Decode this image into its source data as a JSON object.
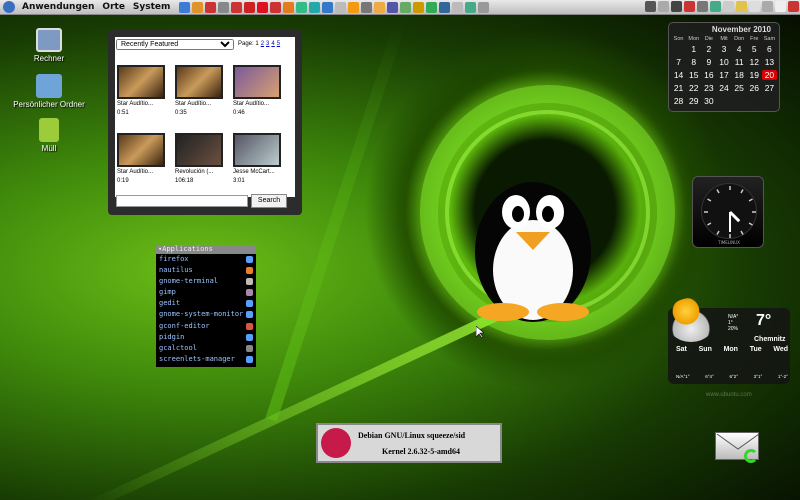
{
  "panel": {
    "menus": [
      "Anwendungen",
      "Orte",
      "System"
    ],
    "launchers": [
      "#3c7cd6",
      "#e0922b",
      "#c33",
      "#888",
      "#c33",
      "#c22",
      "#d12",
      "#c33",
      "#e47b1c",
      "#3b8",
      "#2aa",
      "#3678c8",
      "#bbb",
      "#f39a11",
      "#777",
      "#ea4",
      "#55a",
      "#6a6",
      "#c90",
      "#3a5",
      "#369",
      "#bbb",
      "#4a8",
      "#999"
    ],
    "tray": [
      "#555",
      "#aaa",
      "#444",
      "#c33",
      "#777",
      "#4a8",
      "#ccc",
      "#e1c24b",
      "#ddd",
      "#aaa",
      "#eee",
      "#c33"
    ]
  },
  "desktop_icons": [
    {
      "label": "Rechner",
      "color": "#7d9bc2"
    },
    {
      "label": "Persönlicher Ordner",
      "color": "#6fa4d8"
    },
    {
      "label": "Müll",
      "color": "#9ccc3a"
    }
  ],
  "video_widget": {
    "dropdown": "Recently Featured",
    "page_label": "Page:",
    "pages": [
      "1",
      "2",
      "3",
      "4",
      "5"
    ],
    "videos": [
      {
        "title": "Star Audítio...",
        "dur": "0:51"
      },
      {
        "title": "Star Audítio...",
        "dur": "0:35"
      },
      {
        "title": "Star Audítio...",
        "dur": "0:46"
      },
      {
        "title": "Star Audítio...",
        "dur": "0:19"
      },
      {
        "title": "Revolución (...",
        "dur": "106:18"
      },
      {
        "title": "Jesse McCart...",
        "dur": "3:01"
      }
    ],
    "search_button": "Search"
  },
  "apps": {
    "header": "▾Applications",
    "items": [
      {
        "name": "firefox",
        "color": "#58a0ff"
      },
      {
        "name": "nautilus",
        "color": "#e87f2b"
      },
      {
        "name": "gnome-terminal",
        "color": "#bbb"
      },
      {
        "name": "gimp",
        "color": "#a8a"
      },
      {
        "name": "gedit",
        "color": "#58a0ff"
      },
      {
        "name": "gnome-system-monitor",
        "color": "#58a0ff"
      },
      {
        "name": "gconf-editor",
        "color": "#d54"
      },
      {
        "name": "pidgin",
        "color": "#58a0ff"
      },
      {
        "name": "gcalctool",
        "color": "#888"
      },
      {
        "name": "screenlets-manager",
        "color": "#58a0ff"
      }
    ]
  },
  "calendar": {
    "month": "November 2010",
    "day_names": [
      "Son",
      "Mon",
      "Die",
      "Mit",
      "Don",
      "Fre",
      "Sam"
    ],
    "days": [
      "",
      "1",
      "2",
      "3",
      "4",
      "5",
      "6",
      "7",
      "8",
      "9",
      "10",
      "11",
      "12",
      "13",
      "14",
      "15",
      "16",
      "17",
      "18",
      "19",
      "20",
      "21",
      "22",
      "23",
      "24",
      "25",
      "26",
      "27",
      "28",
      "29",
      "30",
      "",
      "",
      "",
      ""
    ],
    "today": "20"
  },
  "clock": {
    "hour": 4,
    "minute": 30,
    "brand": "TIMELINUX"
  },
  "weather": {
    "temp": "7°",
    "city": "Chemnitz",
    "small": [
      "N/A°",
      "1°",
      "20%"
    ],
    "days": [
      "Sat",
      "Sun",
      "Mon",
      "Tue",
      "Wed"
    ],
    "temps": [
      "N/A°1°",
      "6°4°",
      "6°2°",
      "3°1°",
      "1°-2°"
    ]
  },
  "debian": {
    "line1": "Debian GNU/Linux squeeze/sid",
    "line2": "Kernel 2.6.32-5-amd64"
  },
  "watermark": "www.ubuntu.com"
}
